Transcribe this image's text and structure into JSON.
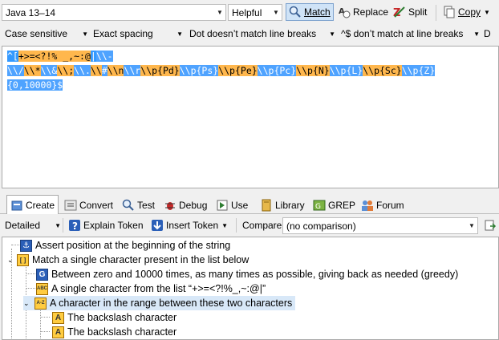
{
  "toolbar1": {
    "flavor": "Java 13–14",
    "helpful": "Helpful",
    "match": "Match",
    "replace": "Replace",
    "split": "Split",
    "copy": "Copy"
  },
  "toolbar2": {
    "case": "Case sensitive",
    "spacing": "Exact spacing",
    "dot": "Dot doesn’t match line breaks",
    "anchors": "^$ don’t match at line breaks",
    "extra": "D"
  },
  "regex": {
    "line1": [
      "^[",
      "+>=<?!% _,~:@",
      "|",
      "\\\\-"
    ],
    "line2": [
      "\\\\/",
      "\\\\*",
      "\\\\&",
      "\\\\;",
      "\\\\.",
      "\\\\",
      "#",
      "\\\\n",
      "\\\\r",
      "\\\\p{Pd}",
      "\\\\p{Ps}",
      "\\\\p{Pe}",
      "\\\\p{Pc}",
      "\\\\p{N}",
      "\\\\p{L}",
      "\\\\p{Sc}",
      "\\\\p{Z}"
    ],
    "line3": "{0,10000}$"
  },
  "tabs": [
    "Create",
    "Convert",
    "Test",
    "Debug",
    "Use",
    "Library",
    "GREP",
    "Forum"
  ],
  "toolbar3": {
    "detailed": "Detailed",
    "explain": "Explain Token",
    "insert": "Insert Token",
    "compare": "Compare",
    "compare_value": "(no comparison)"
  },
  "tree": [
    {
      "badge": "⚓",
      "text": "Assert position at the beginning of the string"
    },
    {
      "badge": "[ ]",
      "text": "Match a single character present in the list below"
    },
    {
      "badge": "G",
      "text": "Between zero and 10000 times, as many times as possible, giving back as needed (greedy)"
    },
    {
      "badge": "ABC",
      "text": "A single character from the list “+>=<?!%_,~:@|”"
    },
    {
      "badge": "A-Z",
      "text": "A character in the range between these two characters"
    },
    {
      "badge": "A",
      "text": "The backslash character"
    },
    {
      "badge": "A",
      "text": "The backslash character"
    }
  ]
}
